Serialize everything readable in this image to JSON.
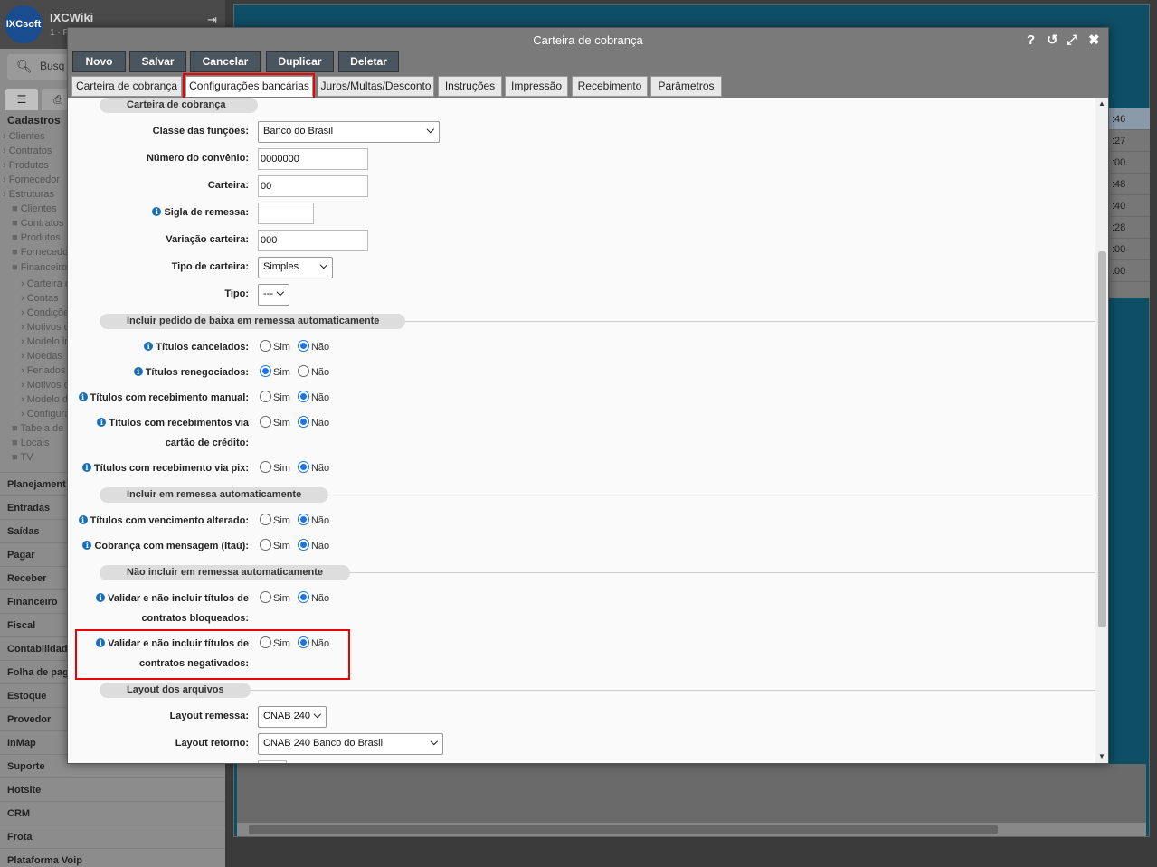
{
  "app": {
    "name": "IXCWiki",
    "logo_text": "IXCsoft",
    "subtitle": "1 - F",
    "search_placeholder": "Busq"
  },
  "sidebar": {
    "section": "Cadastros",
    "sub_items": [
      {
        "label": "Clientes",
        "indent": 0,
        "type": "arrow"
      },
      {
        "label": "Contratos",
        "indent": 0,
        "type": "arrow"
      },
      {
        "label": "Produtos",
        "indent": 0,
        "type": "arrow"
      },
      {
        "label": "Fornecedor",
        "indent": 0,
        "type": "arrow"
      },
      {
        "label": "Estruturas",
        "indent": 0,
        "type": "arrow"
      },
      {
        "label": "Clientes",
        "indent": 1,
        "type": "folder"
      },
      {
        "label": "Contratos",
        "indent": 1,
        "type": "folder"
      },
      {
        "label": "Produtos",
        "indent": 1,
        "type": "folder"
      },
      {
        "label": "Fornecedo",
        "indent": 1,
        "type": "folder"
      },
      {
        "label": "Financeiro",
        "indent": 1,
        "type": "folder-open"
      },
      {
        "label": "Carteira d",
        "indent": 2,
        "type": "arrow"
      },
      {
        "label": "Contas",
        "indent": 2,
        "type": "arrow"
      },
      {
        "label": "Condiçõe",
        "indent": 2,
        "type": "arrow"
      },
      {
        "label": "Motivos d",
        "indent": 2,
        "type": "arrow"
      },
      {
        "label": "Modelo im",
        "indent": 2,
        "type": "arrow"
      },
      {
        "label": "Moedas",
        "indent": 2,
        "type": "arrow"
      },
      {
        "label": "Feriados",
        "indent": 2,
        "type": "arrow"
      },
      {
        "label": "Motivos d",
        "indent": 2,
        "type": "arrow"
      },
      {
        "label": "Modelo de",
        "indent": 2,
        "type": "arrow"
      },
      {
        "label": "Configura",
        "indent": 2,
        "type": "arrow"
      },
      {
        "label": "Tabela de",
        "indent": 1,
        "type": "folder"
      },
      {
        "label": "Locais",
        "indent": 1,
        "type": "folder"
      },
      {
        "label": "TV",
        "indent": 1,
        "type": "folder"
      }
    ],
    "main_items": [
      "Planejament",
      "Entradas",
      "Saídas",
      "Pagar",
      "Receber",
      "Financeiro",
      "Fiscal",
      "Contabilidad",
      "Folha de pag",
      "Estoque",
      "Provedor",
      "InMap",
      "Suporte",
      "Hotsite",
      "CRM",
      "Frota",
      "Plataforma Voip"
    ]
  },
  "background": {
    "times": [
      ":46",
      ":27",
      ":00",
      ":48",
      ":40",
      ":28",
      ":00",
      ":00"
    ]
  },
  "modal": {
    "title": "Carteira de cobrança",
    "toolbar": [
      "Novo",
      "Salvar",
      "Cancelar",
      "Duplicar",
      "Deletar"
    ],
    "tabs": [
      "Carteira de cobrança",
      "Configurações bancárias",
      "Juros/Multas/Desconto",
      "Instruções",
      "Impressão",
      "Recebimento",
      "Parâmetros"
    ],
    "active_tab": 1,
    "sections": {
      "carteira": "Carteira de cobrança",
      "baixa": "Incluir pedido de baixa em remessa automaticamente",
      "incluir": "Incluir em remessa automaticamente",
      "nao_incluir": "Não incluir em remessa automaticamente",
      "layout": "Layout dos arquivos"
    },
    "fields": {
      "classe_label": "Classe das funções:",
      "classe_value": "Banco do Brasil",
      "convenio_label": "Número do convênio:",
      "convenio_value": "0000000",
      "carteira_label": "Carteira:",
      "carteira_value": "00",
      "sigla_label": "Sigla de remessa:",
      "sigla_value": "",
      "variacao_label": "Variação carteira:",
      "variacao_value": "000",
      "tipo_carteira_label": "Tipo de carteira:",
      "tipo_carteira_value": "Simples",
      "tipo_label": "Tipo:",
      "tipo_value": "---",
      "layout_remessa_label": "Layout remessa:",
      "layout_remessa_value": "CNAB 240",
      "layout_retorno_label": "Layout retorno:",
      "layout_retorno_value": "CNAB 240 Banco do Brasil"
    },
    "radio_sim": "Sim",
    "radio_nao": "Não",
    "radios": {
      "cancelados": {
        "label": "Títulos cancelados:",
        "value": "nao"
      },
      "renegociados": {
        "label": "Títulos renegociados:",
        "value": "sim"
      },
      "manual": {
        "label": "Títulos com recebimento manual:",
        "value": "nao"
      },
      "cartao1": {
        "label": "Títulos com recebimentos via",
        "value": "nao"
      },
      "cartao2": {
        "label": "cartão de crédito:"
      },
      "pix": {
        "label": "Títulos com recebimento via pix:",
        "value": "nao"
      },
      "vencimento": {
        "label": "Títulos com vencimento alterado:",
        "value": "nao"
      },
      "mensagem": {
        "label": "Cobrança com mensagem (Itaú):",
        "value": "nao"
      },
      "bloqueados1": {
        "label": "Validar e não incluir títulos de",
        "value": "nao"
      },
      "bloqueados2": {
        "label": "contratos bloqueados:"
      },
      "negativados1": {
        "label": "Validar e não incluir títulos de",
        "value": "nao"
      },
      "negativados2": {
        "label": "contratos negativados:"
      }
    }
  }
}
